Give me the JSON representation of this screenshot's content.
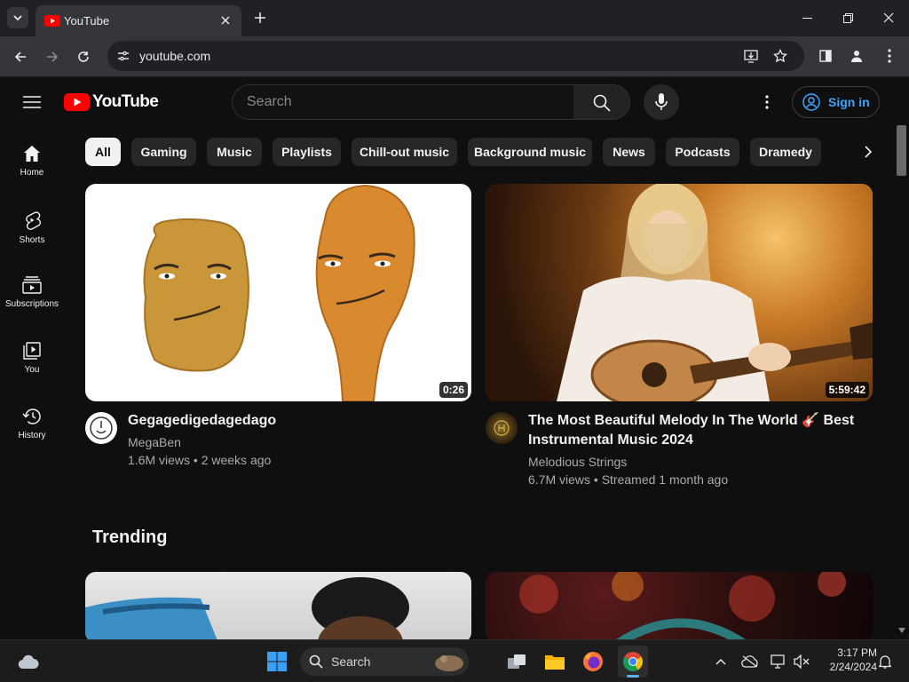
{
  "browser": {
    "tab_title": "YouTube",
    "url": "youtube.com"
  },
  "header": {
    "logo_text": "YouTube",
    "search_placeholder": "Search",
    "sign_in_label": "Sign in"
  },
  "sidebar": {
    "items": [
      {
        "label": "Home",
        "icon": "home-icon"
      },
      {
        "label": "Shorts",
        "icon": "shorts-icon"
      },
      {
        "label": "Subscriptions",
        "icon": "subscriptions-icon"
      },
      {
        "label": "You",
        "icon": "you-icon"
      },
      {
        "label": "History",
        "icon": "history-icon"
      }
    ]
  },
  "chips": [
    "All",
    "Gaming",
    "Music",
    "Playlists",
    "Chill-out music",
    "Background music",
    "News",
    "Podcasts",
    "Dramedy"
  ],
  "videos": [
    {
      "title": "Gegagedigedagedago",
      "channel": "MegaBen",
      "meta": "1.6M views • 2 weeks ago",
      "duration": "0:26"
    },
    {
      "title_line1": "The Most Beautiful Melody In The World 🎸 Best",
      "title_line2": "Instrumental Music 2024",
      "channel": "Melodious Strings",
      "meta": "6.7M views • Streamed 1 month ago",
      "duration": "5:59:42"
    }
  ],
  "trending": {
    "heading": "Trending"
  },
  "taskbar": {
    "search_label": "Search",
    "time": "3:17 PM",
    "date": "2/24/2024"
  },
  "colors": {
    "youtube_red": "#ff0000",
    "link_blue": "#3ea6ff",
    "background": "#0f0f0f"
  }
}
